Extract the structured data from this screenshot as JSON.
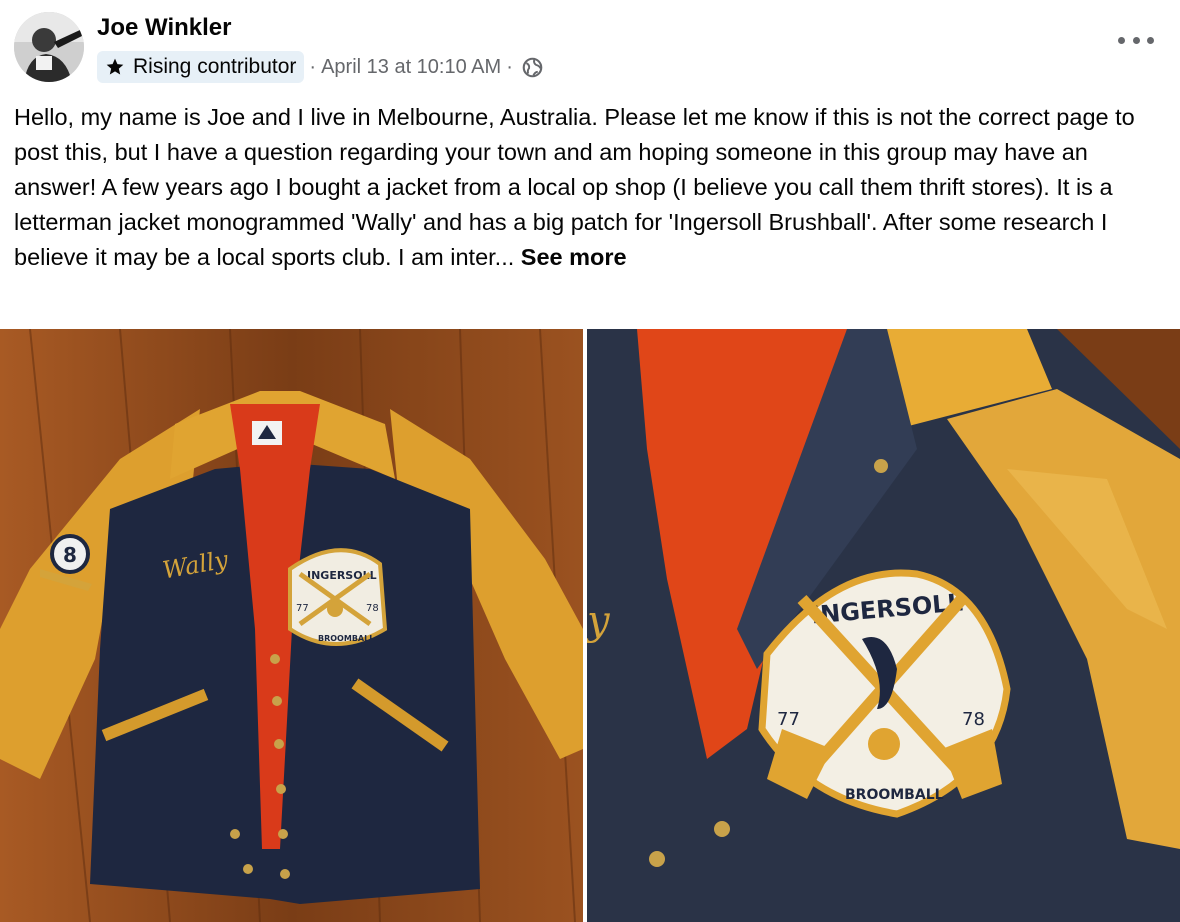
{
  "post": {
    "author": "Joe Winkler",
    "badge": "Rising contributor",
    "separator1": "·",
    "timestamp": "April 13 at 10:10 AM",
    "separator2": "·",
    "body": "Hello, my name is Joe and I live in Melbourne, Australia. Please let me know if this is not the correct page to post this, but I have a question regarding your town and am hoping someone in this group may have an answer! A few years ago I bought a jacket from a local op shop (I believe you call them thrift stores). It is a letterman jacket monogrammed 'Wally' and has a big patch for 'Ingersoll Brushball'. After some research I believe it may be a local sports club. I am inter...",
    "see_more": "See more"
  },
  "icons": {
    "badge": "star-icon",
    "privacy": "globe-icon",
    "menu": "more-options-icon"
  },
  "colors": {
    "text": "#050505",
    "secondary_text": "#65676b",
    "badge_bg": "#e7f0f7",
    "jacket_navy": "#1f2a44",
    "jacket_sleeve": "#e3a530",
    "lining": "#e4401c",
    "floor": "#8a4a1e"
  },
  "photos": {
    "left": {
      "monogram": "Wally",
      "patch_top": "INGERSOLL",
      "patch_bottom": "BROOMBALL",
      "patch_left": "77",
      "patch_right": "78",
      "sleeve_patch": "8"
    },
    "right": {
      "patch_top": "INGERSOLL",
      "patch_bottom": "BROOMBALL",
      "patch_left": "77",
      "patch_right": "78"
    }
  }
}
